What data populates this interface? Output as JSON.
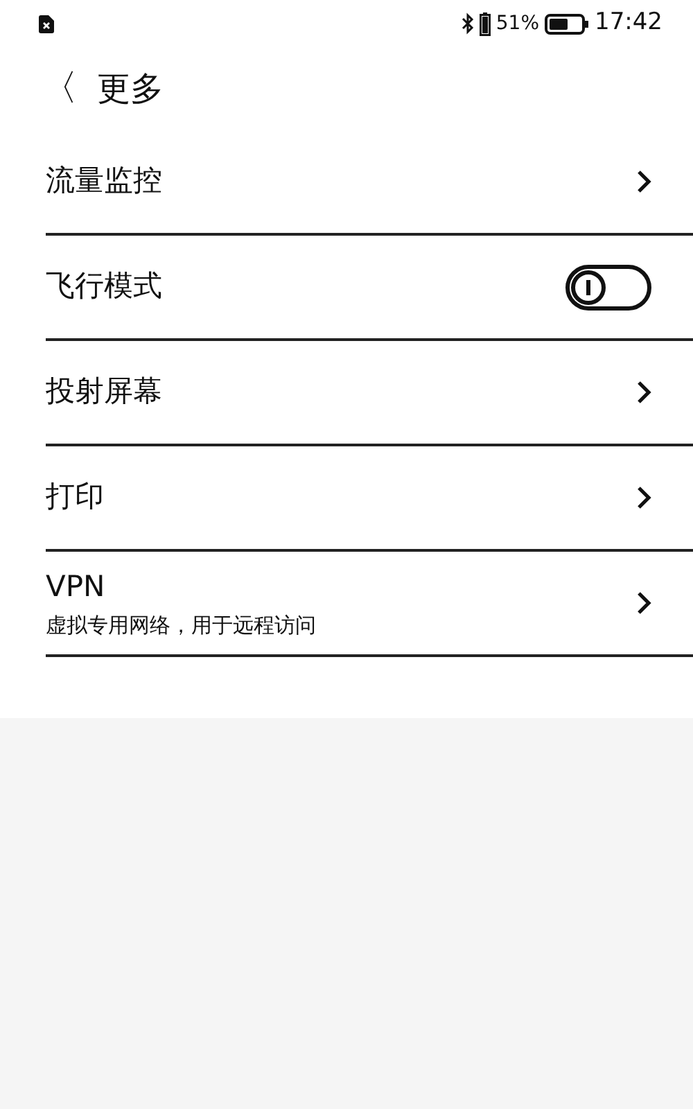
{
  "status_bar": {
    "battery_percent": "51%",
    "time": "17:42"
  },
  "header": {
    "back": "〈",
    "title": "更多"
  },
  "items": [
    {
      "kind": "link",
      "label": "流量监控"
    },
    {
      "kind": "toggle",
      "label": "飞行模式",
      "on": false
    },
    {
      "kind": "link",
      "label": "投射屏幕"
    },
    {
      "kind": "link",
      "label": "打印"
    },
    {
      "kind": "link",
      "label": "VPN",
      "subtitle": "虚拟专用网络，用于远程访问"
    }
  ]
}
